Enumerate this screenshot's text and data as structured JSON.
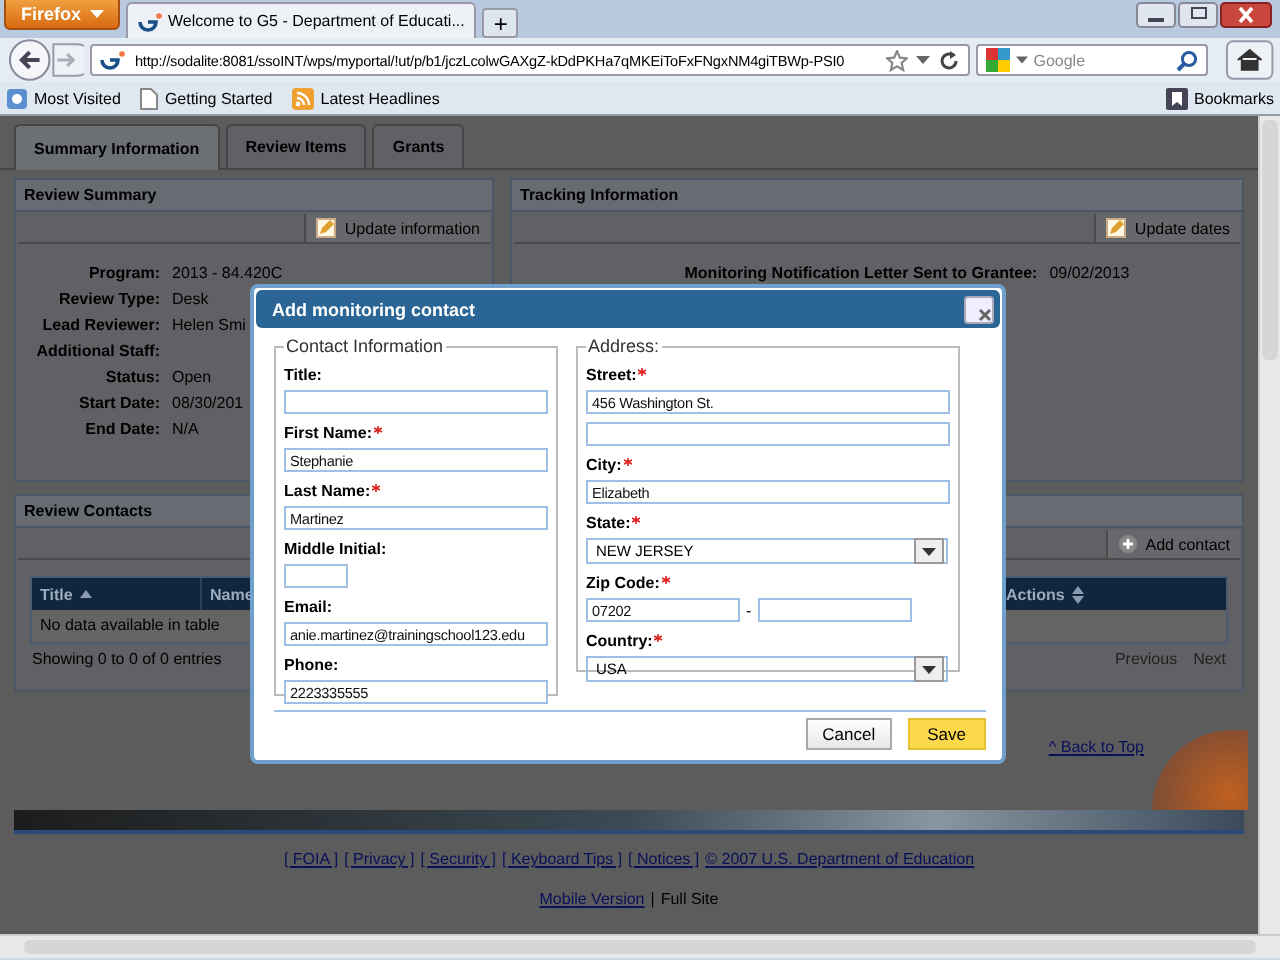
{
  "browser": {
    "menu_button": "Firefox",
    "tab_title": "Welcome to G5 - Department of Educati...",
    "new_tab": "+",
    "url": "http://sodalite:8081/ssoINT/wps/myportal/!ut/p/b1/jczLcolwGAXgZ-kDdPKHa7qMKEiToFxFNgxNM4giTBWp-PSI0",
    "search_placeholder": "Google",
    "bookmarks": [
      "Most Visited",
      "Getting Started",
      "Latest Headlines"
    ],
    "bookmarks_menu": "Bookmarks"
  },
  "tabs": [
    {
      "label": "Summary Information",
      "selected": true
    },
    {
      "label": "Review Items",
      "selected": false
    },
    {
      "label": "Grants",
      "selected": false
    }
  ],
  "review_summary": {
    "title": "Review Summary",
    "action": "Update information",
    "fields": [
      {
        "label": "Program:",
        "value": "2013 - 84.420C"
      },
      {
        "label": "Review Type:",
        "value": "Desk"
      },
      {
        "label": "Lead Reviewer:",
        "value": "Helen Smi"
      },
      {
        "label": "Additional Staff:"
      },
      {
        "label": "Status:",
        "value": "Open"
      },
      {
        "label": "Start Date:",
        "value": "08/30/201"
      },
      {
        "label": "End Date:",
        "value": "N/A"
      }
    ]
  },
  "tracking": {
    "title": "Tracking Information",
    "action": "Update dates",
    "fields": [
      {
        "label": "Monitoring Notification Letter Sent to Grantee:",
        "value": "09/02/2013"
      }
    ]
  },
  "review_contacts": {
    "title": "Review Contacts",
    "action": "Add contact",
    "columns": [
      {
        "label": "Title",
        "kind": "sorted"
      },
      {
        "label": "Name",
        "kind": "plain"
      },
      {
        "label": "Actions",
        "kind": "sortable"
      }
    ],
    "empty_message": "No data available in table",
    "info": "Showing 0 to 0 of 0 entries",
    "pagination": [
      "Previous",
      "Next"
    ]
  },
  "back_to_top": "^ Back to Top",
  "footer": {
    "links": [
      "[ FOIA ]",
      "[ Privacy ]",
      "[ Security ]",
      "[ Keyboard Tips ]",
      "[ Notices ]",
      "© 2007 U.S. Department of Education"
    ],
    "mobile_link": "Mobile Version",
    "separator": "|",
    "full_site": "Full Site"
  },
  "dialog": {
    "title": "Add monitoring contact",
    "contact": {
      "legend": "Contact Information",
      "fields": [
        {
          "kind": "text",
          "label": "Title:",
          "required": false
        },
        {
          "kind": "text",
          "label": "First Name:",
          "required": true,
          "value": "Stephanie"
        },
        {
          "kind": "text",
          "label": "Last Name:",
          "required": true,
          "value": "Martinez"
        },
        {
          "kind": "short",
          "label": "Middle Initial:",
          "required": false
        },
        {
          "kind": "text",
          "label": "Email:",
          "required": false,
          "value": "anie.martinez@trainingschool123.edu"
        },
        {
          "kind": "text",
          "label": "Phone:",
          "required": false,
          "value": "2223335555"
        }
      ]
    },
    "address": {
      "legend": "Address:",
      "fields": [
        {
          "kind": "text2",
          "label": "Street:",
          "required": true,
          "value": "456 Washington St."
        },
        {
          "kind": "text",
          "label": "City:",
          "required": true,
          "value": "Elizabeth"
        },
        {
          "kind": "select",
          "label": "State:",
          "required": true,
          "value": "NEW JERSEY"
        },
        {
          "kind": "zip",
          "label": "Zip Code:",
          "required": true,
          "value": "07202",
          "separator": "-"
        },
        {
          "kind": "select",
          "label": "Country:",
          "required": true,
          "value": "USA"
        }
      ]
    },
    "buttons": [
      {
        "label": "Cancel",
        "kind": "secondary"
      },
      {
        "label": "Save",
        "kind": "primary"
      }
    ]
  }
}
